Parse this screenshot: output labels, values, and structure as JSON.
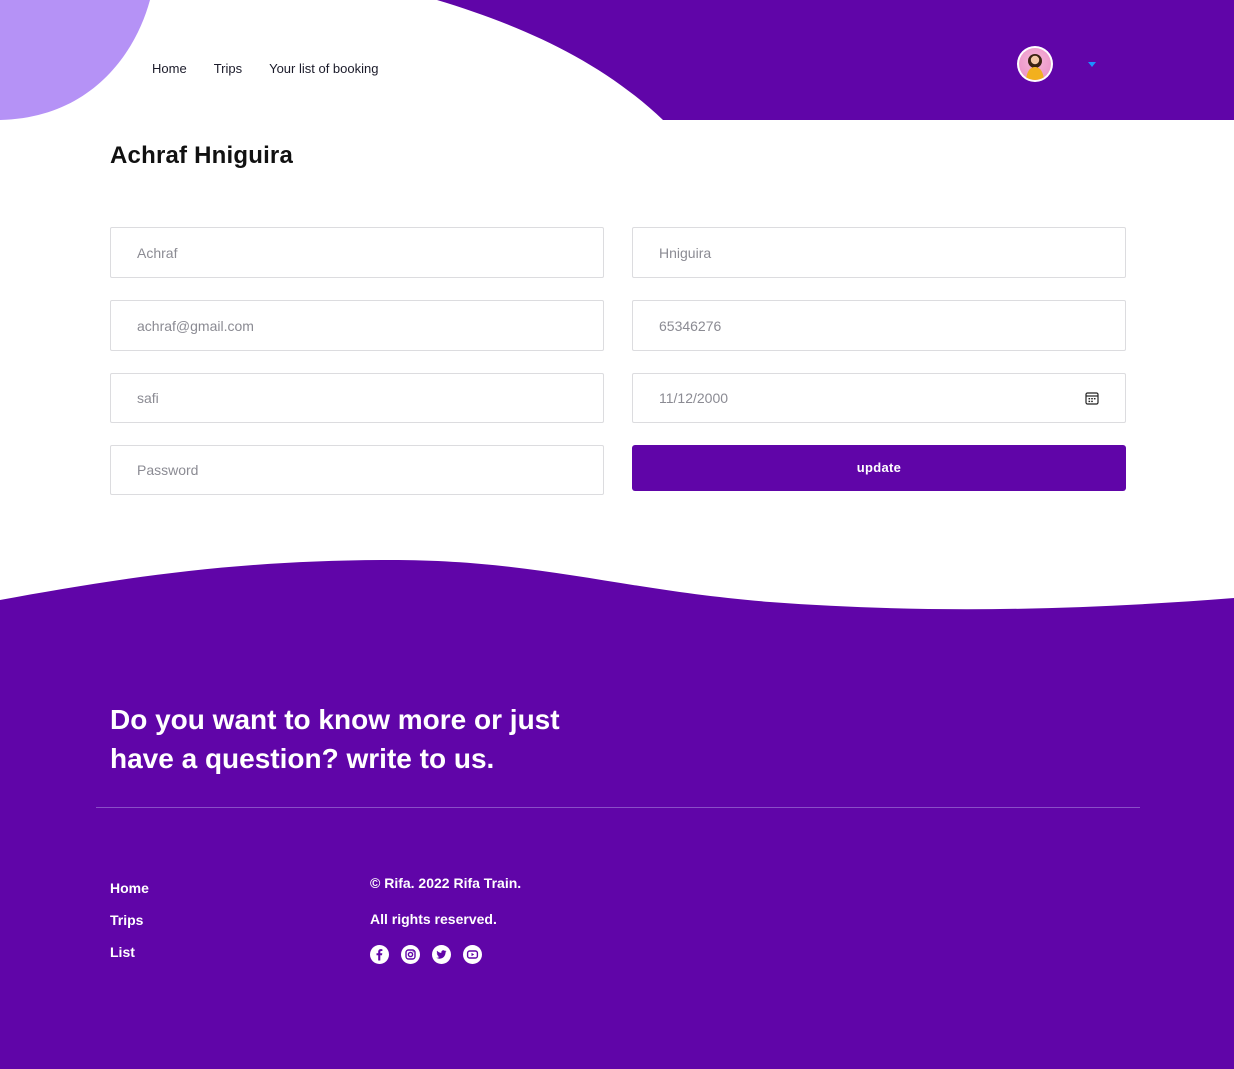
{
  "colors": {
    "primary": "#6005a8",
    "lavender": "#b592f6",
    "white": "#ffffff"
  },
  "nav": {
    "items": [
      "Home",
      "Trips",
      "Your list of booking"
    ]
  },
  "profile": {
    "name": "Achraf Hniguira"
  },
  "form": {
    "first_name": "Achraf",
    "last_name": "Hniguira",
    "email": "achraf@gmail.com",
    "phone": "65346276",
    "city": "safi",
    "birth_date": "11/12/2000",
    "password_placeholder": "Password",
    "update_label": "update"
  },
  "footer": {
    "heading": "Do you want to know more or just have a question? write to us.",
    "links": [
      "Home",
      "Trips",
      "List"
    ],
    "copyright": "© Rifa. 2022 Rifa Train.",
    "rights": "All rights reserved.",
    "social_icons": [
      "facebook-icon",
      "instagram-icon",
      "twitter-icon",
      "youtube-icon"
    ]
  }
}
